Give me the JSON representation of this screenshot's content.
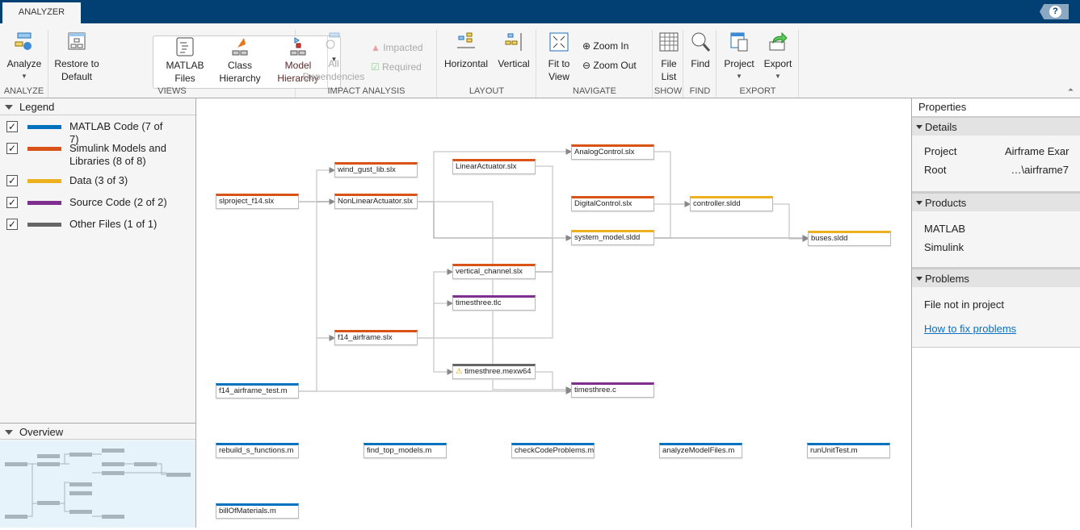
{
  "tab": "ANALYZER",
  "help": "?",
  "toolbar": {
    "analyze": {
      "label": "Analyze",
      "group": "ANALYZE"
    },
    "views": {
      "restore": "Restore to Default",
      "matlab_files": "MATLAB Files",
      "class_hierarchy": "Class Hierarchy",
      "model_hierarchy": "Model Hierarchy",
      "group": "VIEWS"
    },
    "impact": {
      "all_deps": "All Dependencies",
      "impacted": "Impacted",
      "required": "Required",
      "group": "IMPACT ANALYSIS"
    },
    "layout": {
      "horizontal": "Horizontal",
      "vertical": "Vertical",
      "group": "LAYOUT"
    },
    "navigate": {
      "fit": "Fit to View",
      "zoom_in": "Zoom In",
      "zoom_out": "Zoom Out",
      "group": "NAVIGATE"
    },
    "show": {
      "file_list": "File List",
      "group": "SHOW"
    },
    "find": {
      "find": "Find",
      "group": "FIND"
    },
    "export": {
      "project": "Project",
      "export": "Export",
      "group": "EXPORT"
    }
  },
  "legend": {
    "title": "Legend",
    "items": [
      {
        "label": "MATLAB Code (7 of 7)",
        "color": "#0072bd"
      },
      {
        "label": "Simulink Models and Libraries (8 of 8)",
        "color": "#d95319"
      },
      {
        "label": "Data (3 of 3)",
        "color": "#edb120"
      },
      {
        "label": "Source Code (2 of 2)",
        "color": "#7e2f8e"
      },
      {
        "label": "Other Files (1 of 1)",
        "color": "#666666"
      }
    ]
  },
  "overview": {
    "title": "Overview"
  },
  "graph": {
    "nodes": [
      {
        "name": "slproject_f14.slx",
        "type": "model"
      },
      {
        "name": "wind_gust_lib.slx",
        "type": "model"
      },
      {
        "name": "NonLinearActuator.slx",
        "type": "model"
      },
      {
        "name": "LinearActuator.slx",
        "type": "model"
      },
      {
        "name": "AnalogControl.slx",
        "type": "model"
      },
      {
        "name": "DigitalControl.slx",
        "type": "model"
      },
      {
        "name": "system_model.sldd",
        "type": "data"
      },
      {
        "name": "controller.sldd",
        "type": "data"
      },
      {
        "name": "buses.sldd",
        "type": "data"
      },
      {
        "name": "vertical_channel.slx",
        "type": "model"
      },
      {
        "name": "timesthree.tlc",
        "type": "source"
      },
      {
        "name": "f14_airframe.slx",
        "type": "model"
      },
      {
        "name": "timesthree.mexw64",
        "type": "other",
        "warning": true
      },
      {
        "name": "f14_airframe_test.m",
        "type": "code"
      },
      {
        "name": "timesthree.c",
        "type": "source"
      },
      {
        "name": "rebuild_s_functions.m",
        "type": "code"
      },
      {
        "name": "find_top_models.m",
        "type": "code"
      },
      {
        "name": "checkCodeProblems.m",
        "type": "code"
      },
      {
        "name": "analyzeModelFiles.m",
        "type": "code"
      },
      {
        "name": "runUnitTest.m",
        "type": "code"
      },
      {
        "name": "billOfMaterials.m",
        "type": "code"
      }
    ]
  },
  "properties": {
    "title": "Properties",
    "details": {
      "title": "Details",
      "project_label": "Project",
      "project_value": "Airframe Exar",
      "root_label": "Root",
      "root_value": "…\\airframe7"
    },
    "products": {
      "title": "Products",
      "items": [
        "MATLAB",
        "Simulink"
      ]
    },
    "problems": {
      "title": "Problems",
      "text": "File not in project",
      "link": "How to fix problems"
    }
  }
}
